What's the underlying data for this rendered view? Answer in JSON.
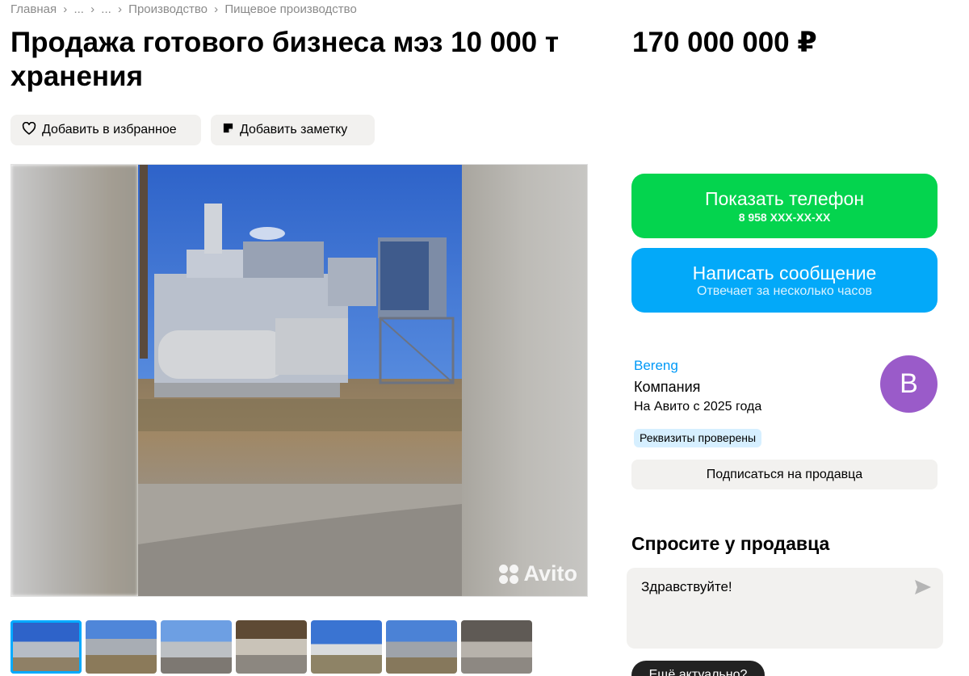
{
  "breadcrumb": {
    "items": [
      "Главная",
      "...",
      "...",
      "Производство",
      "Пищевое производство"
    ]
  },
  "listing": {
    "title": "Продажа готового бизнеса мэз 10 000 т хранения",
    "price": "170 000 000 ₽"
  },
  "actions": {
    "favorite_label": "Добавить в избранное",
    "note_label": "Добавить заметку"
  },
  "gallery": {
    "watermark": "Avito",
    "thumbnail_count": 7,
    "selected_index": 0
  },
  "contact": {
    "show_phone_label": "Показать телефон",
    "phone_masked": "8 958 XXX-XX-XX",
    "write_label": "Написать сообщение",
    "write_sub": "Отвечает за несколько часов"
  },
  "seller": {
    "name": "Bereng",
    "type": "Компания",
    "since": "На Авито с 2025 года",
    "avatar_letter": "B",
    "verified_badge": "Реквизиты проверены",
    "subscribe_label": "Подписаться на продавца"
  },
  "ask": {
    "title": "Спросите у продавца",
    "message": "Здравствуйте!",
    "quick_question": "Ещё актуально?"
  },
  "colors": {
    "phone_button": "#04d44e",
    "message_button": "#03a9f9",
    "seller_link": "#0099f7",
    "avatar": "#9a5bc9",
    "verified_badge_bg": "#d6efff",
    "thumbnail_active": "#00aaff"
  },
  "icons": {
    "favorite": "heart-icon",
    "note": "note-icon",
    "send": "send-icon"
  }
}
